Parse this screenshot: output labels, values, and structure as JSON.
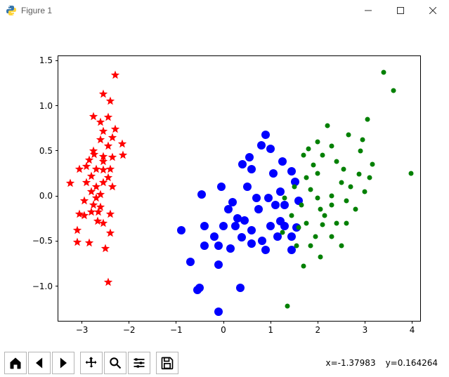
{
  "window": {
    "title": "Figure 1",
    "buttons": {
      "min": "minimize",
      "max": "maximize",
      "close": "close"
    }
  },
  "toolbar": {
    "home": "Home",
    "back": "Back",
    "forward": "Forward",
    "pan": "Pan",
    "zoom": "Zoom",
    "subplots": "Configure subplots",
    "save": "Save figure"
  },
  "status": {
    "x_label": "x=-1.37983",
    "y_label": "y=0.164264"
  },
  "chart_data": {
    "type": "scatter",
    "title": "",
    "xlabel": "",
    "ylabel": "",
    "xlim": [
      -3.5,
      4.2
    ],
    "ylim": [
      -1.4,
      1.55
    ],
    "xticks": [
      -3,
      -2,
      -1,
      0,
      1,
      2,
      3,
      4
    ],
    "yticks": [
      -1.0,
      -0.5,
      0.0,
      0.5,
      1.0,
      1.5
    ],
    "xtick_labels": [
      "−3",
      "−2",
      "−1",
      "0",
      "1",
      "2",
      "3",
      "4"
    ],
    "ytick_labels": [
      "−1.0",
      "−0.5",
      "0.0",
      "0.5",
      "1.0",
      "1.5"
    ],
    "series": [
      {
        "name": "red-stars",
        "marker": "star",
        "color": "#ff0000",
        "x": [
          -3.25,
          -3.1,
          -2.3,
          -2.55,
          -2.4,
          -2.6,
          -2.75,
          -2.45,
          -2.3,
          -2.15,
          -2.13,
          -2.6,
          -2.45,
          -2.35,
          -2.55,
          -2.9,
          -3.05,
          -2.85,
          -2.7,
          -2.55,
          -2.4,
          -2.8,
          -2.55,
          -2.35,
          -2.7,
          -2.45,
          -2.95,
          -2.8,
          -2.6,
          -2.7,
          -2.5,
          -2.6,
          -2.75,
          -2.4,
          -2.8,
          -2.95,
          -2.55,
          -2.67,
          -3.1,
          -3.05,
          -2.85,
          -2.45,
          -2.4,
          -2.35,
          -2.75,
          -2.55,
          -2.55,
          -2.65,
          -2.9,
          -2.74
        ],
        "y": [
          0.14,
          -0.51,
          1.34,
          1.13,
          1.05,
          0.82,
          0.88,
          0.87,
          0.74,
          0.58,
          0.45,
          0.62,
          0.55,
          0.43,
          0.44,
          0.33,
          0.3,
          0.4,
          0.3,
          0.29,
          0.3,
          0.22,
          0.15,
          0.1,
          0.1,
          0.2,
          -0.05,
          0.05,
          0.02,
          -0.02,
          -0.58,
          -0.12,
          -0.1,
          -0.2,
          -0.18,
          -0.22,
          -0.3,
          -0.28,
          -0.38,
          -0.2,
          -0.52,
          -0.96,
          -0.41,
          0.65,
          0.5,
          0.72,
          0.38,
          -0.18,
          0.15,
          0.46
        ]
      },
      {
        "name": "blue-circles",
        "marker": "circle-large",
        "color": "#0000ff",
        "x": [
          0.9,
          0.8,
          1.0,
          0.55,
          0.4,
          0.6,
          1.45,
          1.52,
          1.2,
          0.95,
          0.7,
          1.1,
          1.3,
          0.5,
          1.6,
          0.75,
          0.2,
          0.1,
          -0.05,
          0.3,
          0.45,
          0.6,
          1.0,
          1.2,
          1.3,
          1.55,
          1.45,
          -0.4,
          -0.2,
          0.0,
          -0.1,
          -0.4,
          -0.9,
          -0.1,
          0.15,
          0.35,
          0.25,
          0.6,
          0.9,
          1.15,
          1.45,
          -0.7,
          -0.5,
          -0.55,
          -0.1,
          -0.46,
          1.25,
          1.05,
          0.82,
          0.38
        ],
        "y": [
          0.68,
          0.56,
          0.52,
          0.43,
          0.35,
          0.3,
          0.27,
          0.16,
          0.05,
          -0.02,
          -0.02,
          -0.1,
          -0.1,
          0.1,
          -0.05,
          -0.15,
          -0.07,
          -0.15,
          0.1,
          -0.25,
          -0.27,
          -0.38,
          -0.33,
          -0.28,
          -0.33,
          -0.35,
          -0.45,
          -0.33,
          -0.45,
          -0.33,
          -0.55,
          -0.55,
          -0.38,
          -0.76,
          -0.58,
          -1.02,
          -0.33,
          -0.53,
          -0.6,
          -0.45,
          -0.6,
          -0.73,
          -1.02,
          -1.04,
          -1.28,
          0.02,
          0.38,
          0.25,
          -0.5,
          -0.46
        ]
      },
      {
        "name": "green-dots",
        "marker": "circle-small",
        "color": "#008000",
        "x": [
          3.4,
          3.6,
          3.05,
          2.65,
          2.3,
          2.0,
          1.9,
          1.7,
          1.75,
          2.1,
          2.4,
          2.55,
          2.9,
          3.15,
          3.1,
          2.7,
          2.5,
          2.3,
          2.0,
          1.85,
          2.05,
          2.3,
          2.6,
          2.8,
          3.0,
          2.95,
          2.5,
          1.65,
          1.45,
          1.25,
          1.6,
          1.85,
          2.1,
          2.05,
          1.95,
          1.7,
          1.55,
          2.3,
          2.4,
          2.0,
          1.8,
          1.5,
          2.15,
          1.75,
          1.35,
          3.98,
          2.88,
          2.2,
          2.6,
          1.3
        ],
        "y": [
          1.37,
          1.17,
          0.85,
          0.68,
          0.55,
          0.6,
          0.34,
          0.45,
          0.2,
          0.45,
          0.38,
          0.3,
          0.5,
          0.35,
          0.2,
          0.1,
          0.15,
          0.0,
          -0.02,
          0.07,
          -0.15,
          -0.1,
          -0.05,
          -0.15,
          0.05,
          0.62,
          -0.55,
          -0.1,
          -0.22,
          -0.4,
          -0.35,
          -0.55,
          -0.32,
          -0.68,
          -0.45,
          -0.78,
          -0.55,
          -0.45,
          -0.3,
          0.25,
          0.52,
          0.1,
          -0.22,
          -0.3,
          -1.22,
          0.25,
          0.24,
          0.78,
          -0.3,
          -0.02
        ]
      }
    ]
  }
}
